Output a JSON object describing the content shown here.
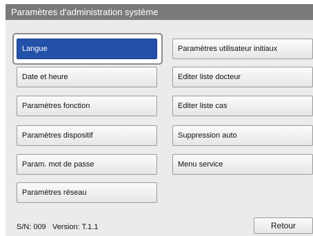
{
  "window": {
    "title": "Paramètres d'administration système"
  },
  "menu": {
    "left": [
      {
        "label": "Langue",
        "selected": true
      },
      {
        "label": "Date et heure"
      },
      {
        "label": "Paramètres fonction"
      },
      {
        "label": "Paramètres dispositif"
      },
      {
        "label": "Param. mot de passe"
      },
      {
        "label": "Paramètres réseau"
      }
    ],
    "right": [
      {
        "label": "Paramètres utilisateur initiaux"
      },
      {
        "label": "Editer liste docteur"
      },
      {
        "label": "Editer liste cas"
      },
      {
        "label": "Suppression auto"
      },
      {
        "label": "Menu service"
      }
    ]
  },
  "footer": {
    "sn_label": "S/N: 009",
    "version_label": "Version: T.1.1",
    "back_label": "Retour"
  },
  "colors": {
    "title_bar": "#7a7a7a",
    "panel": "#ebebeb",
    "selected_button": "#2350a8"
  }
}
